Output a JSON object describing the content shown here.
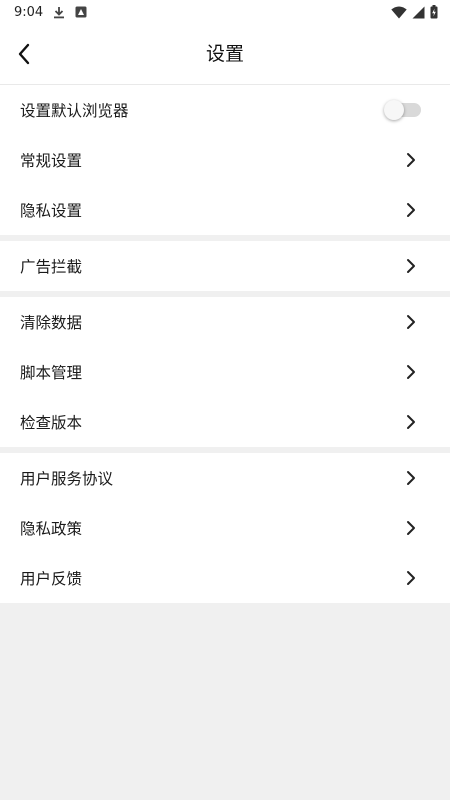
{
  "status_bar": {
    "time": "9:04",
    "icons": [
      "download-icon",
      "app-notification-icon",
      "wifi-icon",
      "signal-icon",
      "battery-charging-icon"
    ]
  },
  "header": {
    "title": "设置",
    "back_icon": "chevron-left-icon"
  },
  "settings": {
    "default_browser": {
      "label": "设置默认浏览器",
      "enabled": false
    },
    "groups": [
      {
        "items": [
          {
            "label": "常规设置"
          },
          {
            "label": "隐私设置"
          }
        ]
      },
      {
        "items": [
          {
            "label": "广告拦截"
          }
        ]
      },
      {
        "items": [
          {
            "label": "清除数据"
          },
          {
            "label": "脚本管理"
          },
          {
            "label": "检查版本"
          }
        ]
      },
      {
        "items": [
          {
            "label": "用户服务协议"
          },
          {
            "label": "隐私政策"
          },
          {
            "label": "用户反馈"
          }
        ]
      }
    ]
  },
  "colors": {
    "background": "#f0f0f0",
    "surface": "#ffffff",
    "text": "#1a1a1a",
    "toggle_off": "#d9d9d9"
  }
}
